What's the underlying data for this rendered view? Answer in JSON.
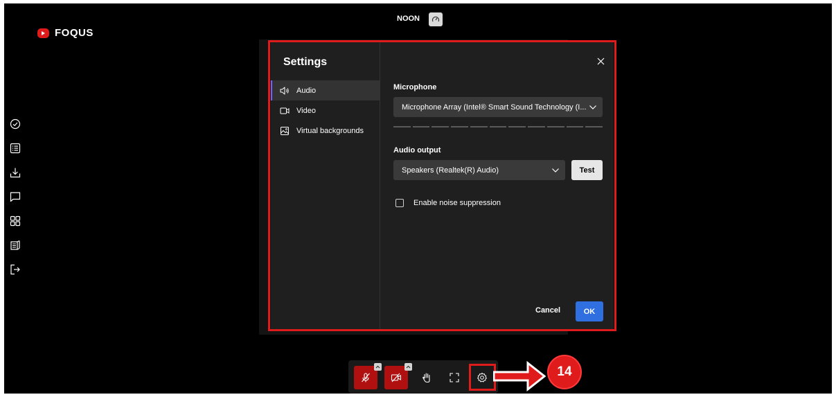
{
  "brand": {
    "name": "FOQUS",
    "accent": "#e01b1b"
  },
  "header": {
    "label": "NOON",
    "timer_icon": "gauge-icon"
  },
  "side_rail": [
    {
      "icon": "check-circle-icon"
    },
    {
      "icon": "list-icon"
    },
    {
      "icon": "download-icon"
    },
    {
      "icon": "chat-icon"
    },
    {
      "icon": "grid-icon"
    },
    {
      "icon": "book-icon"
    },
    {
      "icon": "exit-icon"
    }
  ],
  "settings": {
    "title": "Settings",
    "close_icon": "close-icon",
    "nav": [
      {
        "label": "Audio",
        "icon": "speaker-icon",
        "active": true
      },
      {
        "label": "Video",
        "icon": "camera-icon",
        "active": false
      },
      {
        "label": "Virtual backgrounds",
        "icon": "image-icon",
        "active": false
      }
    ],
    "microphone": {
      "label": "Microphone",
      "value": "Microphone Array (Intel® Smart Sound Technology (I..."
    },
    "audio_output": {
      "label": "Audio output",
      "value": "Speakers (Realtek(R) Audio)",
      "test_label": "Test"
    },
    "noise_suppression": {
      "label": "Enable noise suppression",
      "checked": false
    },
    "cancel_label": "Cancel",
    "ok_label": "OK",
    "accent": "#2f6fe0"
  },
  "toolbar": {
    "buttons": [
      {
        "icon": "mic-off-icon",
        "state": "muted"
      },
      {
        "icon": "camera-off-icon",
        "state": "off"
      },
      {
        "icon": "raise-hand-icon"
      },
      {
        "icon": "fullscreen-icon"
      },
      {
        "icon": "gear-icon",
        "highlighted": true
      }
    ],
    "muted_color": "#b01010"
  },
  "annotation": {
    "step": "14",
    "color": "#e01b1b"
  }
}
